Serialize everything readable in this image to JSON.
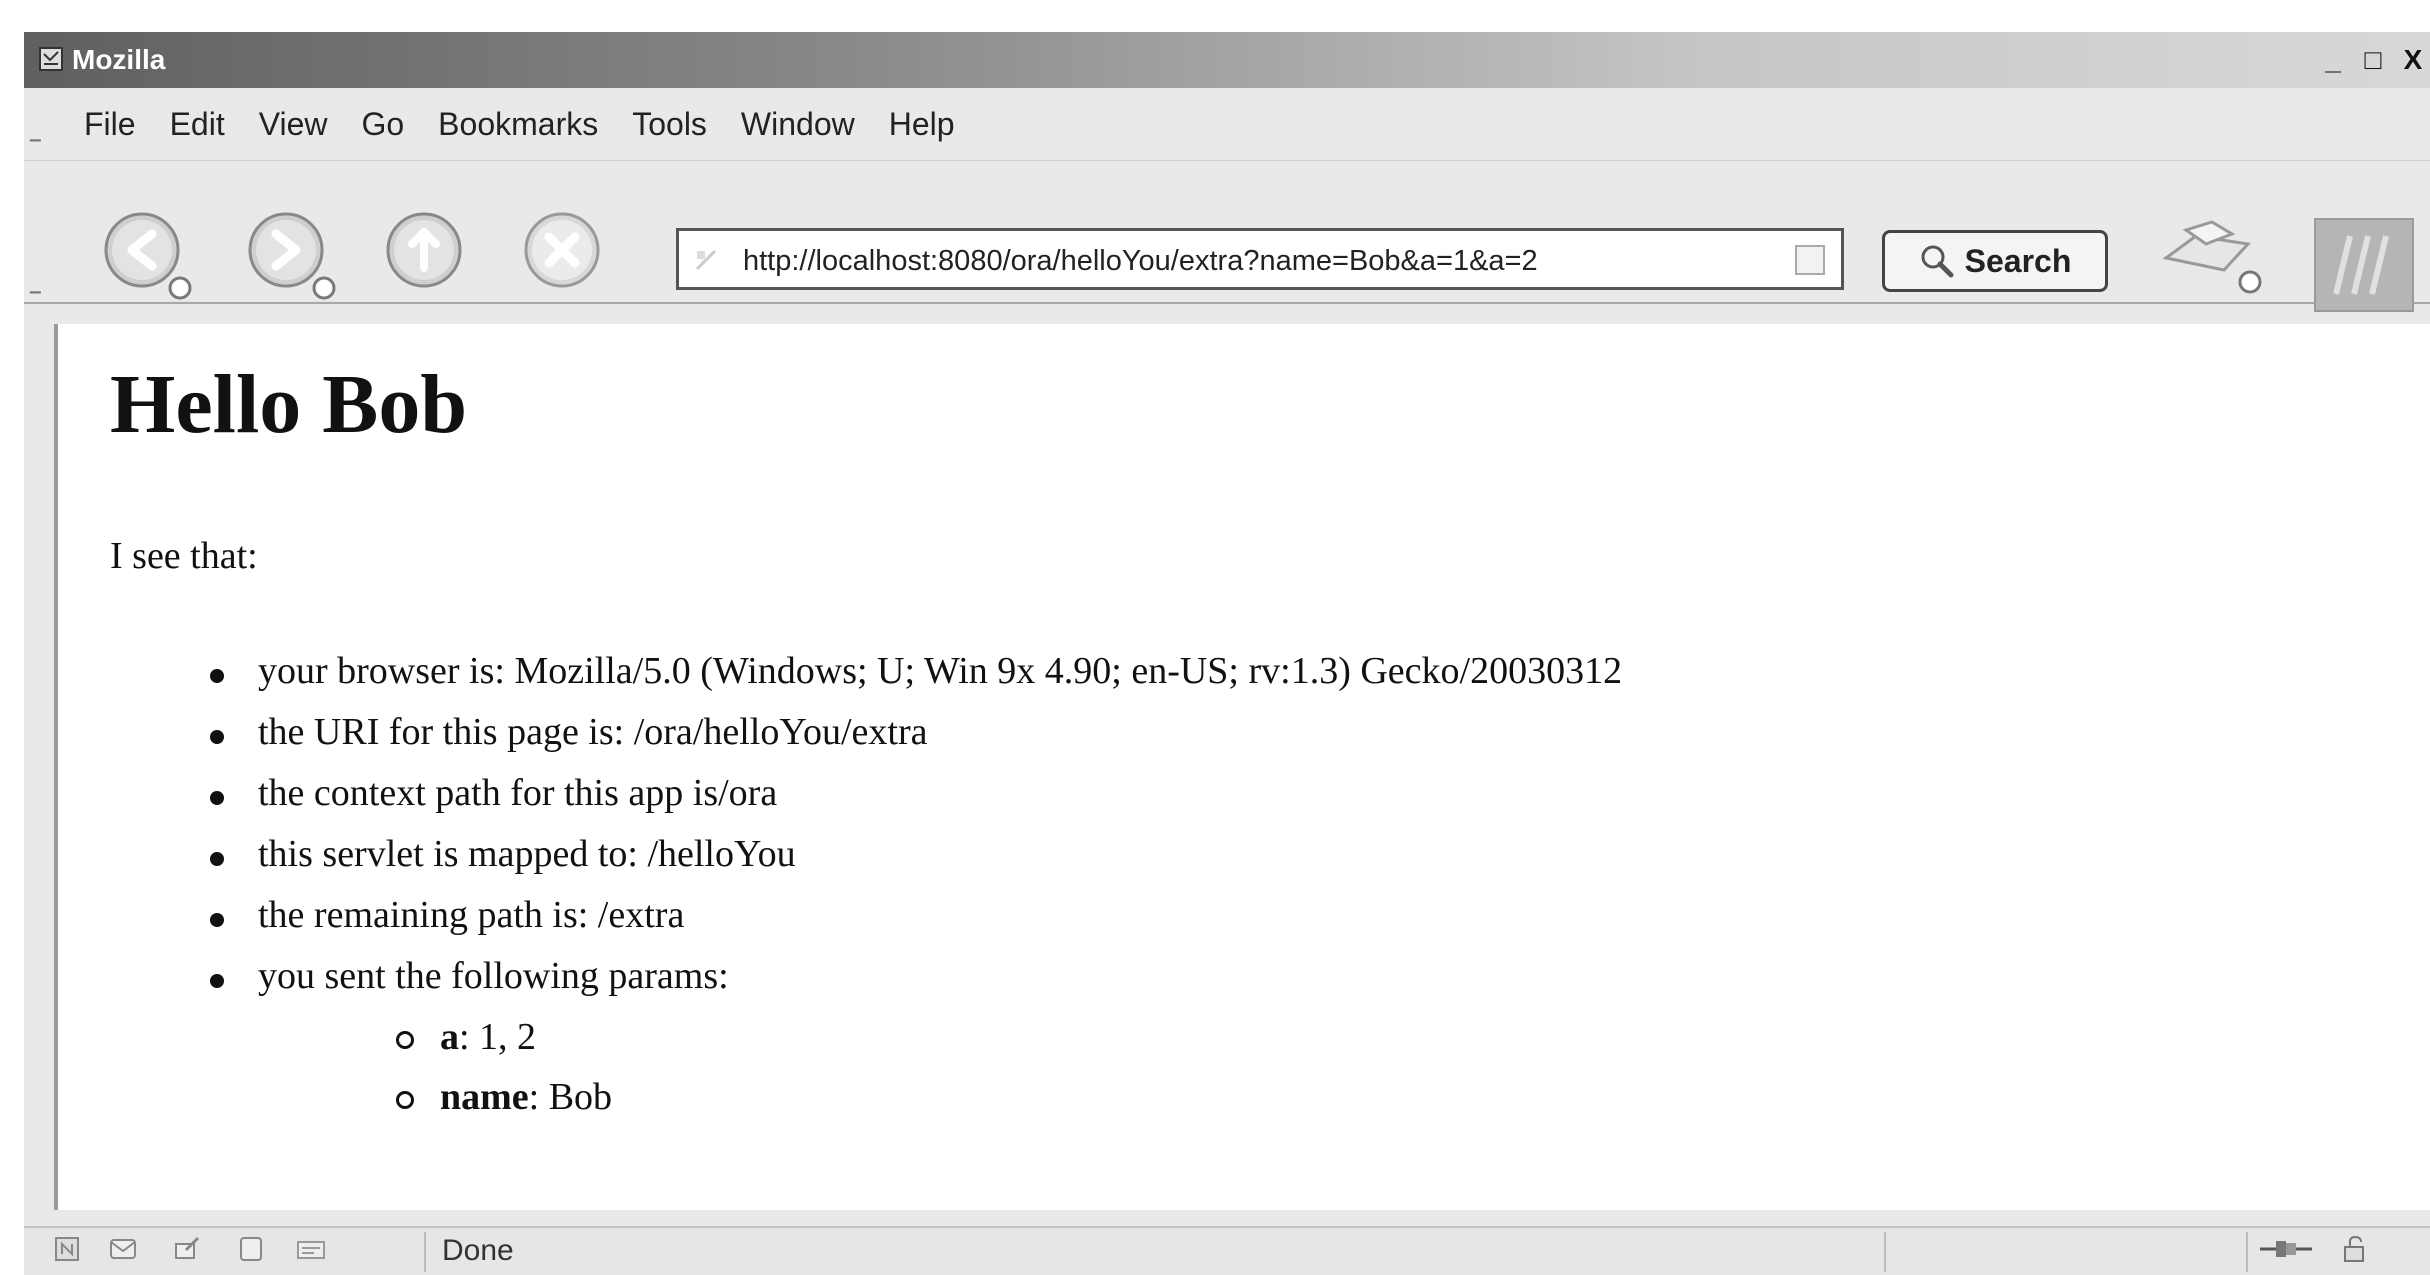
{
  "window": {
    "title": "Mozilla",
    "controls": [
      "_",
      "□",
      "X"
    ]
  },
  "menubar": {
    "items": [
      {
        "label": "File"
      },
      {
        "label": "Edit"
      },
      {
        "label": "View"
      },
      {
        "label": "Go"
      },
      {
        "label": "Bookmarks"
      },
      {
        "label": "Tools"
      },
      {
        "label": "Window"
      },
      {
        "label": "Help"
      }
    ]
  },
  "navbar": {
    "url": "http://localhost:8080/ora/helloYou/extra?name=Bob&a=1&a=2",
    "search_label": "Search",
    "buttons": [
      "back-icon",
      "forward-icon",
      "reload-icon",
      "stop-icon"
    ]
  },
  "page": {
    "heading": "Hello Bob",
    "intro": "I see that:",
    "items": [
      "your browser is: Mozilla/5.0 (Windows; U; Win 9x 4.90; en-US; rv:1.3) Gecko/20030312",
      "the URI for this page is: /ora/helloYou/extra",
      "the context path for this app is/ora",
      "this servlet is mapped to: /helloYou",
      "the remaining path is: /extra",
      "you sent the following params:"
    ],
    "params": [
      {
        "name": "a",
        "value": ": 1, 2"
      },
      {
        "name": "name",
        "value": ": Bob"
      }
    ]
  },
  "status": {
    "text": "Done",
    "icons": [
      "navigator-icon",
      "mail-icon",
      "composer-icon",
      "addressbook-icon",
      "irc-icon",
      "online-icon",
      "security-lock-icon"
    ]
  }
}
